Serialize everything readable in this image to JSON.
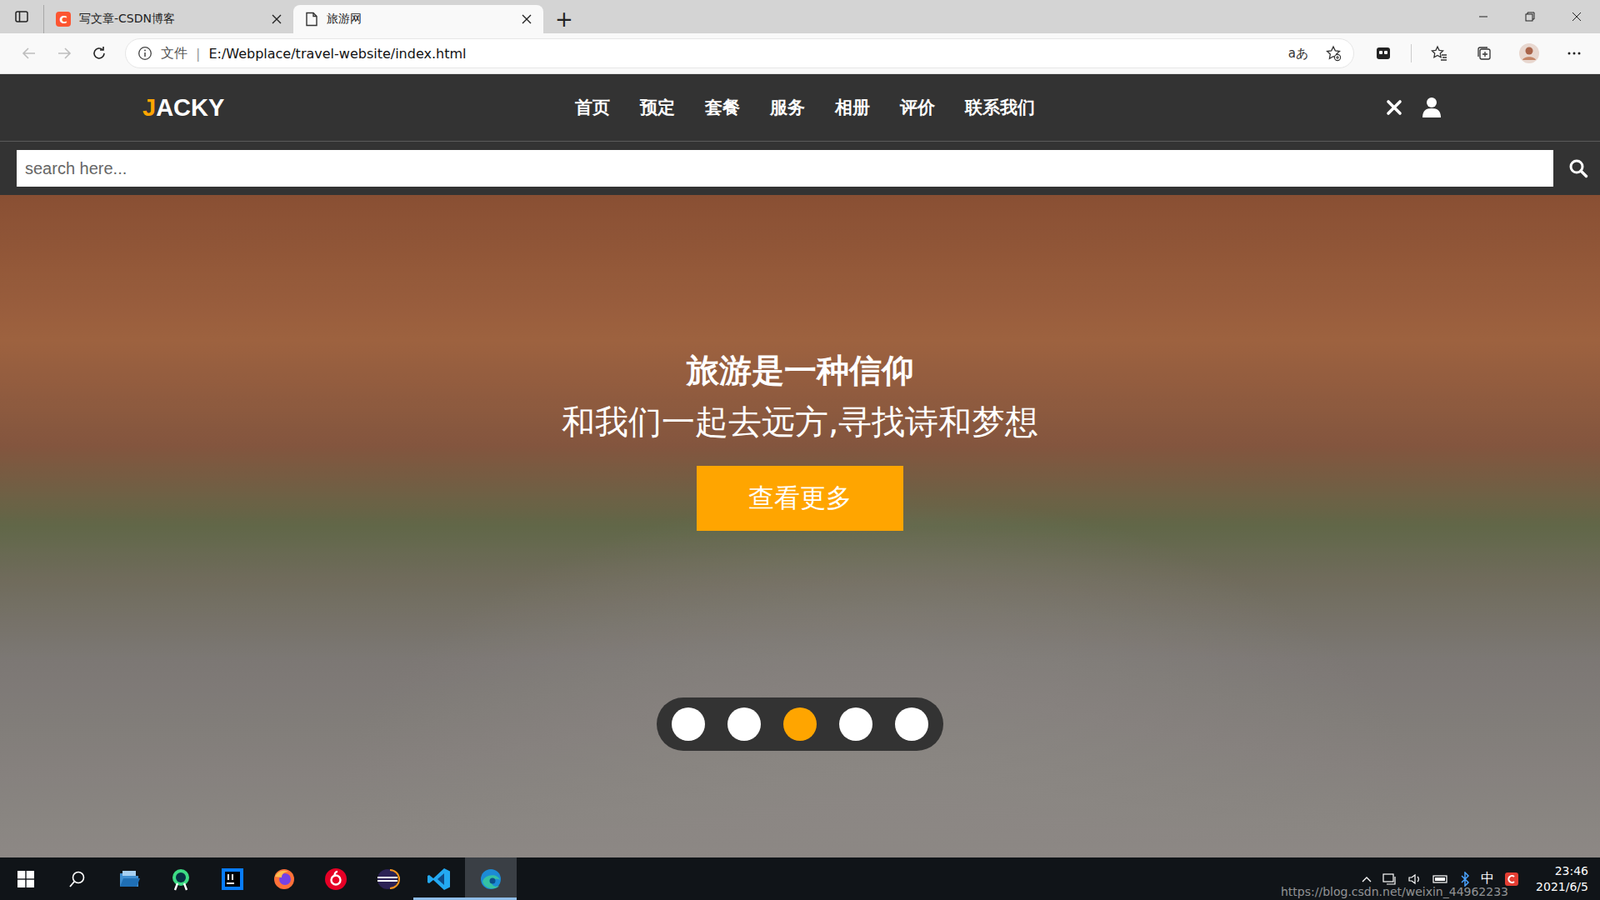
{
  "browser": {
    "tabs": [
      {
        "label": "写文章-CSDN博客",
        "selected": false,
        "favicon": "C"
      },
      {
        "label": "旅游网",
        "selected": true,
        "favicon": ""
      }
    ],
    "new_tab": "+",
    "back_disabled": true,
    "forward_disabled": true,
    "address": {
      "scheme": "文件",
      "separator": "|",
      "url": "E:/Webplace/travel-website/index.html"
    },
    "read_aloud": "aあ"
  },
  "site": {
    "logo": {
      "accent": "J",
      "rest": "ACKY"
    },
    "nav": [
      "首页",
      "预定",
      "套餐",
      "服务",
      "相册",
      "评价",
      "联系我们"
    ],
    "search": {
      "placeholder": "search here..."
    },
    "hero": {
      "title": "旅游是一种信仰",
      "subtitle": "和我们一起去远方,寻找诗和梦想",
      "button": "查看更多"
    },
    "slides": [
      {
        "selected": false
      },
      {
        "selected": false
      },
      {
        "selected": true
      },
      {
        "selected": false
      },
      {
        "selected": false
      }
    ]
  },
  "taskbar": {
    "apps": [
      {
        "kind": "explorer",
        "running": false,
        "active": false
      },
      {
        "kind": "android",
        "running": false,
        "active": false
      },
      {
        "kind": "intellij",
        "running": false,
        "active": false
      },
      {
        "kind": "firefox",
        "running": false,
        "active": false
      },
      {
        "kind": "netease",
        "running": false,
        "active": false
      },
      {
        "kind": "eclipse",
        "running": false,
        "active": false
      },
      {
        "kind": "vscode",
        "running": true,
        "active": false
      },
      {
        "kind": "edge",
        "running": true,
        "active": true
      }
    ],
    "tray": {
      "ime": "中",
      "time": "23:46",
      "date": "2021/6/5"
    },
    "watermark": "https://blog.csdn.net/weixin_44962233"
  }
}
